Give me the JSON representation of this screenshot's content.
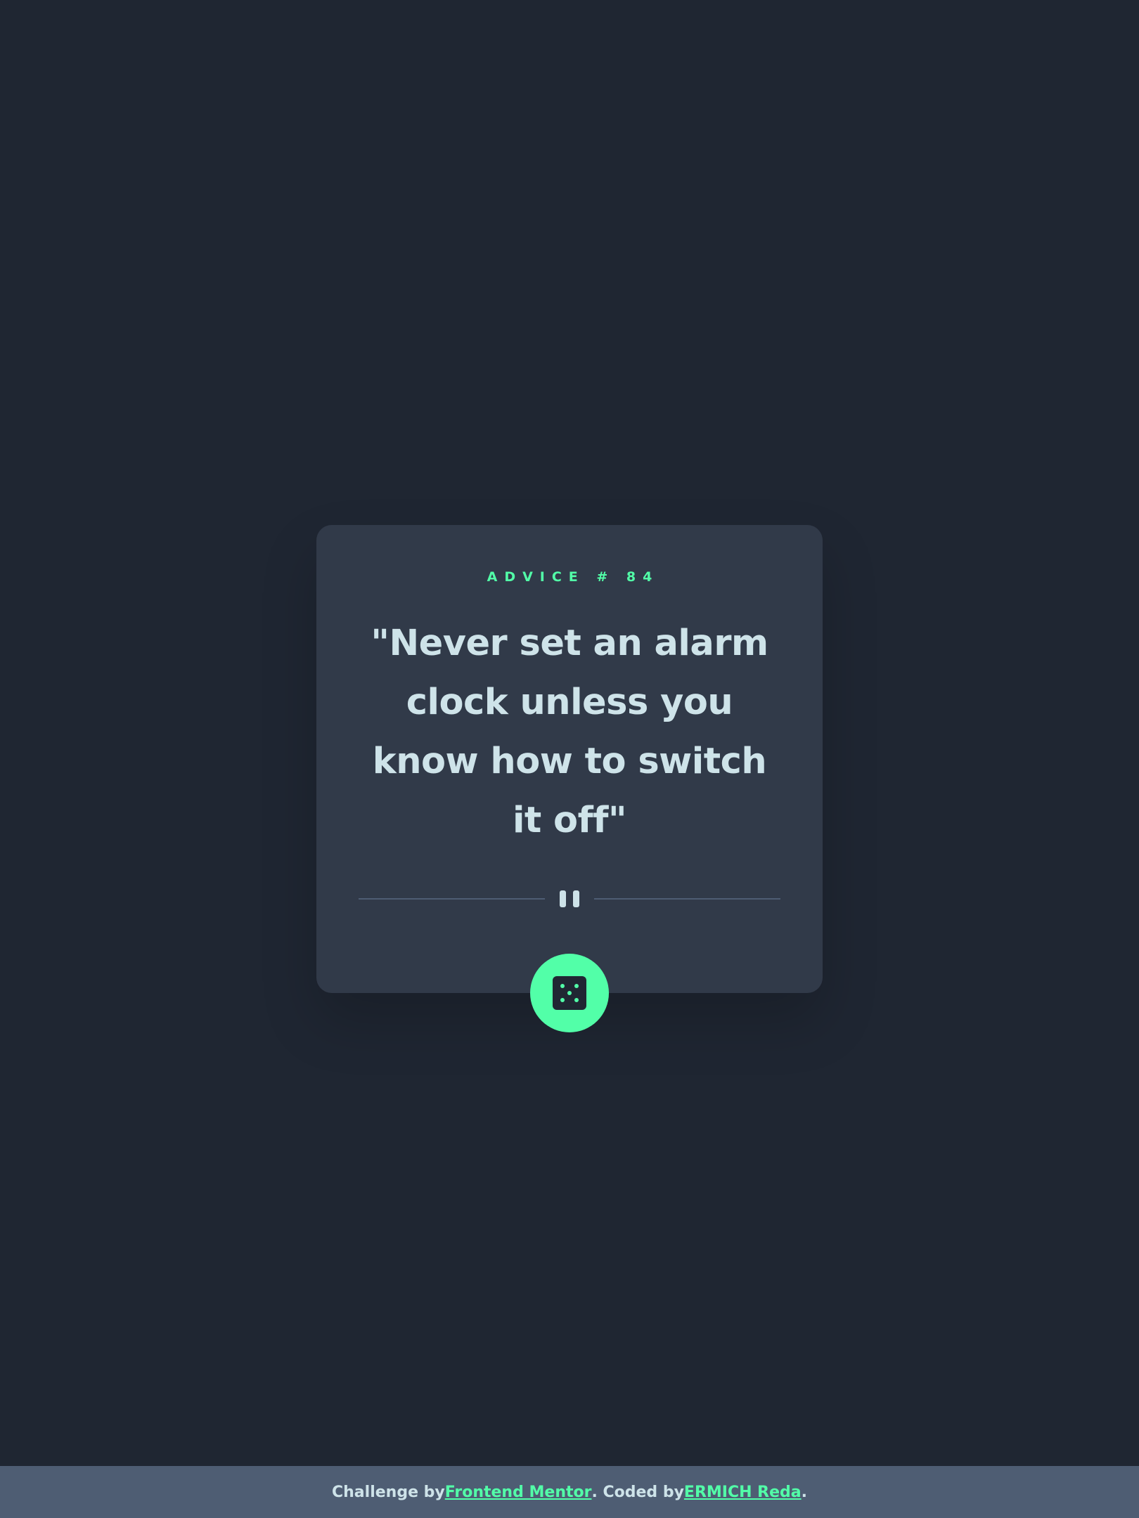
{
  "card": {
    "advice_label": "ADVICE # 84",
    "advice_text": "\"Never set an alarm clock unless you know how to switch it off\""
  },
  "icons": {
    "divider": "pause-icon",
    "button": "dice-icon"
  },
  "footer": {
    "prefix": "Challenge by",
    "link1": "Frontend Mentor",
    "middle": ". Coded by",
    "link2": "ERMICH Reda",
    "suffix": "."
  },
  "colors": {
    "background": "#1f2632",
    "card": "#313a49",
    "accent": "#52ffa8",
    "text": "#cee3e9",
    "footer": "#4e5d73"
  }
}
